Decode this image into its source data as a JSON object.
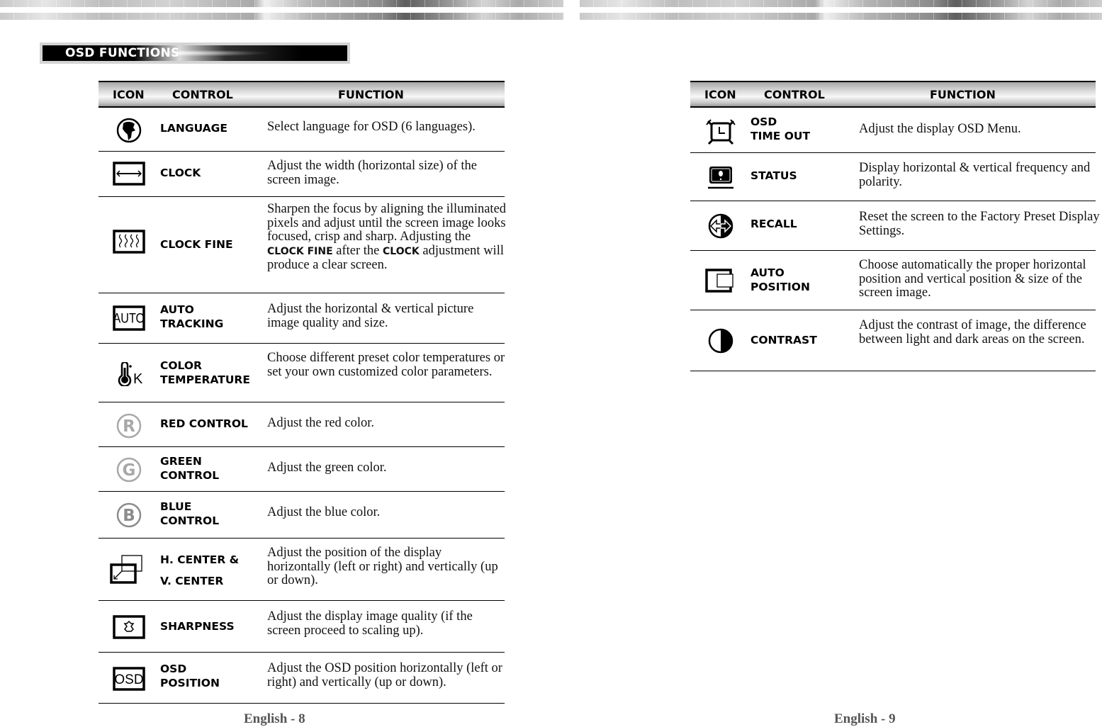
{
  "section_title": "OSD FUNCTIONS",
  "table_headers": {
    "icon": "ICON",
    "control": "CONTROL",
    "function": "FUNCTION"
  },
  "left_page": {
    "rows": [
      {
        "icon": "globe-icon",
        "control": "LANGUAGE",
        "function": "Select language for OSD (6 languages)."
      },
      {
        "icon": "horizontal-width-icon",
        "control": "CLOCK",
        "function": "Adjust the width (horizontal size) of the screen image."
      },
      {
        "icon": "wavy-lines-icon",
        "control": "CLOCK FINE",
        "function_parts": [
          "Sharpen the focus by aligning the illuminated pixels and adjust until the screen image looks focused, crisp and sharp.  Adjusting the ",
          "CLOCK FINE",
          " after the ",
          "CLOCK",
          " adjustment will produce a clear screen."
        ]
      },
      {
        "icon": "auto-icon",
        "icon_text": "AUTO",
        "control": "AUTO\nTRACKING",
        "function": "Adjust the horizontal & vertical picture image quality and size."
      },
      {
        "icon": "thermometer-kelvin-icon",
        "icon_text": "K",
        "control": "COLOR\nTEMPERATURE",
        "function": "Choose different preset color temperatures or set your own customized color parameters."
      },
      {
        "icon": "red-r-icon",
        "icon_text": "R",
        "control": "RED CONTROL",
        "function": "Adjust the red color."
      },
      {
        "icon": "green-g-icon",
        "icon_text": "G",
        "control": "GREEN\nCONTROL",
        "function": "Adjust the green color."
      },
      {
        "icon": "blue-b-icon",
        "icon_text": "B",
        "control": "BLUE\nCONTROL",
        "function": "Adjust the blue color."
      },
      {
        "icon": "center-position-icon",
        "control": "H. CENTER &\n V. CENTER",
        "function": "Adjust the position of the display horizontally (left or right) and vertically (up or down)."
      },
      {
        "icon": "sharpness-icon",
        "control": "SHARPNESS",
        "function": "Adjust the display image quality (if the screen proceed to scaling up)."
      },
      {
        "icon": "osd-position-icon",
        "icon_text": "OSD",
        "control": "OSD\nPOSITION",
        "function": "Adjust the OSD position horizontally (left or right) and vertically (up or down)."
      }
    ],
    "footer": "English - 8"
  },
  "right_page": {
    "rows": [
      {
        "icon": "alarm-clock-icon",
        "control": "OSD\nTIME OUT",
        "function": "Adjust the display OSD Menu."
      },
      {
        "icon": "status-monitor-icon",
        "control": "STATUS",
        "function": "Display horizontal & vertical frequency and polarity."
      },
      {
        "icon": "recall-arrows-icon",
        "control": "RECALL",
        "function": "Reset the screen to the Factory Preset Display Settings."
      },
      {
        "icon": "auto-position-icon",
        "control": "AUTO\nPOSITION",
        "function": "Choose automatically the proper horizontal position and vertical position & size of the screen image."
      },
      {
        "icon": "contrast-icon",
        "control": "CONTRAST",
        "function": "Adjust the contrast of image, the difference between light and dark areas on the screen."
      }
    ],
    "footer": "English - 9"
  },
  "colors": {
    "rgb_icon_gray": "#a8a8a8",
    "blue_icon_gray": "#8c8c8c",
    "footer_gray": "#555555"
  }
}
